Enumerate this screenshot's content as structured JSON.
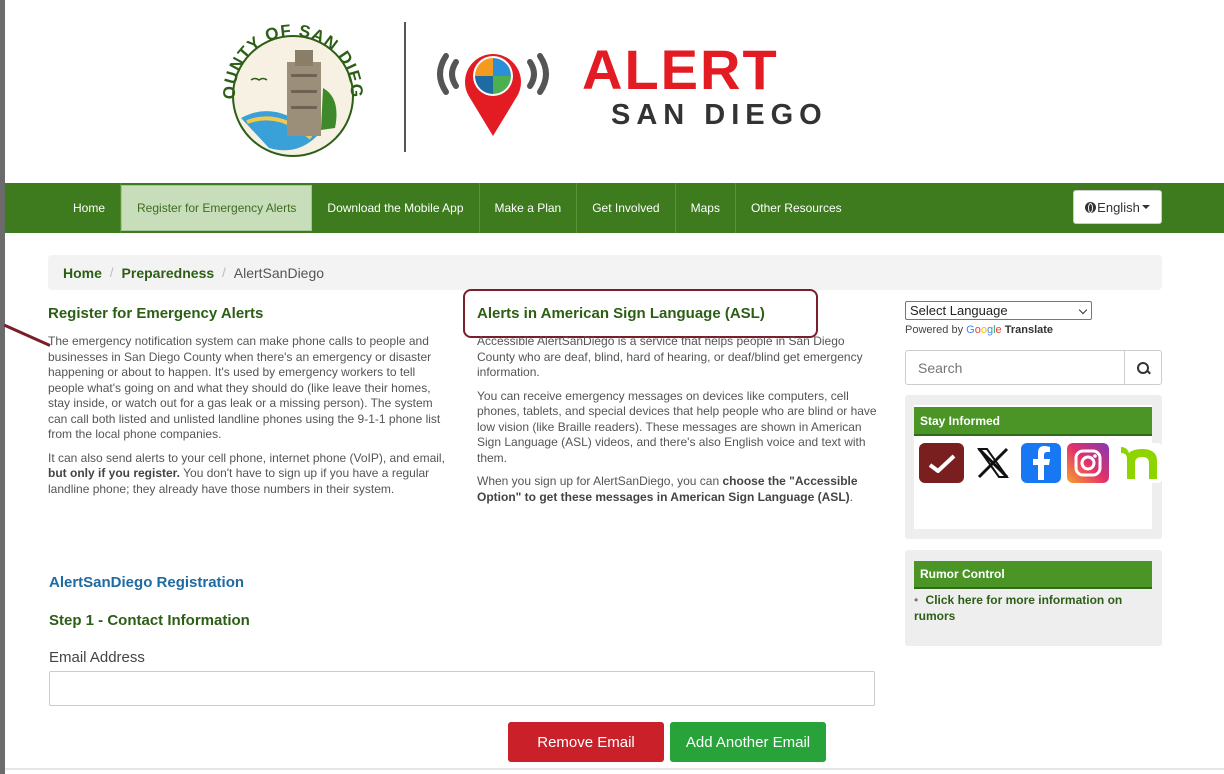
{
  "header": {
    "county_logo_text": "COUNTY OF SAN DIEGO",
    "brand_title": "ALERT",
    "brand_subtitle": "SAN DIEGO"
  },
  "nav": {
    "items": [
      {
        "label": "Home"
      },
      {
        "label": "Register for Emergency Alerts",
        "active": true
      },
      {
        "label": "Download the Mobile App"
      },
      {
        "label": "Make a Plan"
      },
      {
        "label": "Get Involved"
      },
      {
        "label": "Maps"
      },
      {
        "label": "Other Resources"
      }
    ],
    "language_button": "English"
  },
  "breadcrumb": {
    "items": [
      "Home",
      "Preparedness"
    ],
    "current": "AlertSanDiego",
    "separator": "/"
  },
  "left": {
    "title": "Register for Emergency Alerts",
    "para1": "The emergency notification system can make phone calls to people and businesses in San Diego County when there's an emergency or disaster happening or about to happen. It's used by emergency workers to tell people what's going on and what they should do (like leave their homes, stay inside, or watch out for a gas leak or a missing person). The system can call both listed and unlisted landline phones using the 9-1-1 phone list from the local phone companies.",
    "para2_start": "It can also send alerts to your cell phone, internet phone (VoIP), and email, ",
    "para2_bold": "but only if you register.",
    "para2_end": " You don't have to sign up if you have a regular landline phone; they already have those numbers in their system."
  },
  "middle": {
    "title": "Alerts in American Sign Language (ASL)",
    "para1": "Accessible AlertSanDiego is a service that helps people in San Diego County who are deaf, blind, hard of hearing, or deaf/blind get emergency information.",
    "para2": "You can receive emergency messages on devices like computers, cell phones, tablets, and special devices that help people who are blind or have low vision (like Braille readers). These messages are shown in American Sign Language (ASL) videos, and there's also English voice and text with them.",
    "para3_start": "When you sign up for AlertSanDiego, you can ",
    "para3_bold": "choose the \"Accessible Option\" to get these messages in American Sign Language (ASL)",
    "para3_end": "."
  },
  "registration": {
    "title": "AlertSanDiego Registration",
    "step_title": "Step 1 - Contact Information",
    "email_label": "Email Address",
    "email_value": "",
    "remove_button": "Remove Email",
    "add_button": "Add Another Email"
  },
  "sidebar": {
    "language_select": "Select Language",
    "powered_by": "Powered by",
    "google": "Google",
    "translate": "Translate",
    "search_placeholder": "Search",
    "stay_informed_title": "Stay Informed",
    "social_icons": [
      "alertsandiego-app-icon",
      "x-icon",
      "facebook-icon",
      "instagram-icon",
      "nextdoor-icon"
    ],
    "rumor_title": "Rumor Control",
    "rumor_link": "Click here for more information on rumors"
  },
  "colors": {
    "nav_green": "#3e7b1f",
    "alert_red": "#e31b23",
    "remove_red": "#c9202a",
    "add_green": "#27a33a",
    "highlight_box": "#7a1f2a"
  }
}
